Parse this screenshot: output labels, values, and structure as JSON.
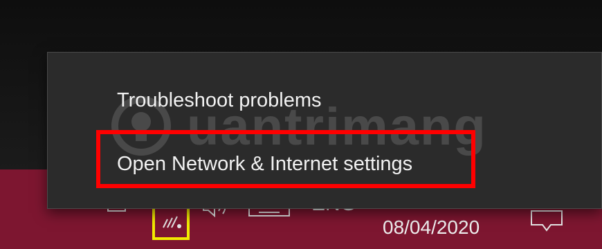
{
  "flyout": {
    "items": [
      {
        "label": "Troubleshoot problems"
      },
      {
        "label": "Open Network & Internet settings"
      }
    ]
  },
  "taskbar": {
    "chevron_icon": "chevron-up-icon",
    "language": "ENG",
    "date": "08/04/2020"
  },
  "watermark": {
    "text": "uantrimang",
    "logo": "quantrimang-logo"
  },
  "colors": {
    "taskbar": "#7d1630",
    "flyout": "#2b2b2b",
    "highlight_red": "#ff0000",
    "highlight_yellow": "#f2ea00"
  }
}
